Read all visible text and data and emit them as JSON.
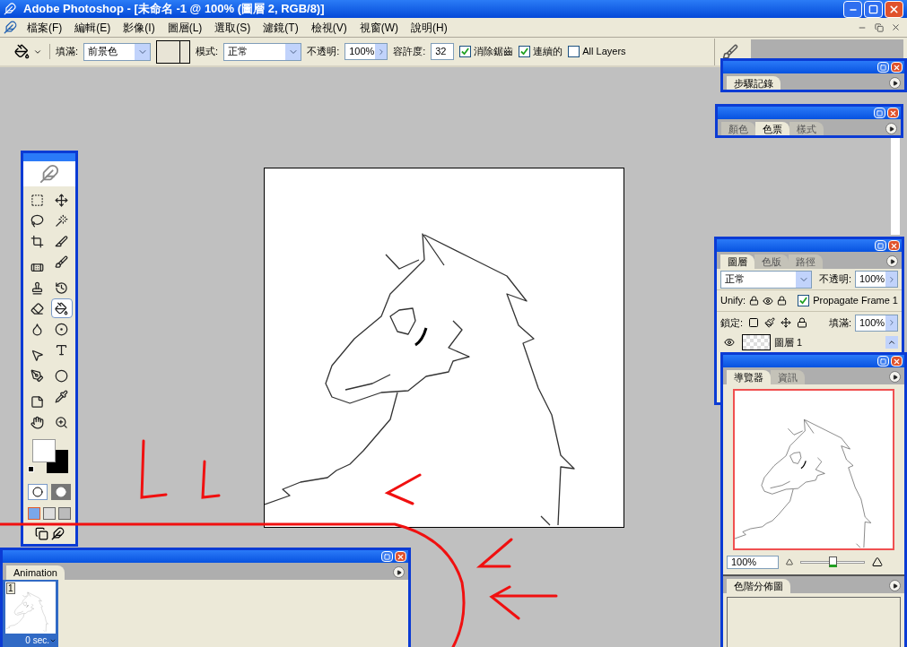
{
  "window": {
    "title": "Adobe Photoshop - [未命名 -1 @ 100% (圖層 2, RGB/8)]"
  },
  "menu": [
    "檔案(F)",
    "編輯(E)",
    "影像(I)",
    "圖層(L)",
    "選取(S)",
    "濾鏡(T)",
    "檢視(V)",
    "視窗(W)",
    "說明(H)"
  ],
  "options_bar": {
    "fill_label": "填滿:",
    "fill_value": "前景色",
    "mode_label": "模式:",
    "mode_value": "正常",
    "opacity_label": "不透明:",
    "opacity_value": "100%",
    "tolerance_label": "容許度:",
    "tolerance_value": "32",
    "checkboxes": [
      {
        "label": "消除鋸齒",
        "checked": true
      },
      {
        "label": "連續的",
        "checked": true
      },
      {
        "label": "All Layers",
        "checked": false
      }
    ]
  },
  "toolbox": {
    "tools": [
      {
        "selected": false
      },
      {
        "selected": false
      },
      {
        "selected": false
      },
      {
        "selected": false
      },
      {
        "selected": false
      },
      {
        "selected": false
      },
      {
        "selected": false
      },
      {
        "selected": false
      },
      {
        "selected": false
      },
      {
        "selected": false
      },
      {
        "selected": false
      },
      {
        "selected": true
      },
      {
        "selected": false
      },
      {
        "selected": false
      },
      {
        "selected": false
      },
      {
        "selected": false
      },
      {
        "selected": false
      },
      {
        "selected": false
      },
      {
        "selected": false
      },
      {
        "selected": false
      },
      {
        "selected": false
      },
      {
        "selected": false
      }
    ]
  },
  "history_panel": {
    "tabs": [
      {
        "label": "步驟記錄",
        "selected": true
      }
    ]
  },
  "color_panel": {
    "tabs": [
      {
        "label": "顏色",
        "selected": false
      },
      {
        "label": "色票",
        "selected": true
      },
      {
        "label": "樣式",
        "selected": false
      }
    ]
  },
  "layers_panel": {
    "tabs": [
      {
        "label": "圖層",
        "selected": true
      },
      {
        "label": "色版",
        "selected": false
      },
      {
        "label": "路徑",
        "selected": false
      }
    ],
    "blend_mode": "正常",
    "opacity_label": "不透明:",
    "opacity_value": "100%",
    "unify_label": "Unify:",
    "propagate": {
      "label": "Propagate Frame 1",
      "checked": true
    },
    "lock_label": "鎖定:",
    "fill_label": "填滿:",
    "fill_value": "100%",
    "layers": [
      {
        "name": "圖層 1",
        "visible": true
      }
    ]
  },
  "navigator_panel": {
    "tabs": [
      {
        "label": "導覽器",
        "selected": true
      },
      {
        "label": "資訊",
        "selected": false
      }
    ],
    "zoom": "100%",
    "zoom_slider": {
      "level": 0.5
    }
  },
  "histogram_panel": {
    "tabs": [
      {
        "label": "色階分佈圖",
        "selected": true
      }
    ]
  },
  "animation_panel": {
    "tabs": [
      {
        "label": "Animation",
        "selected": true
      }
    ],
    "frames": [
      {
        "number": "1",
        "delay": "0 sec.",
        "selected": true
      }
    ]
  }
}
